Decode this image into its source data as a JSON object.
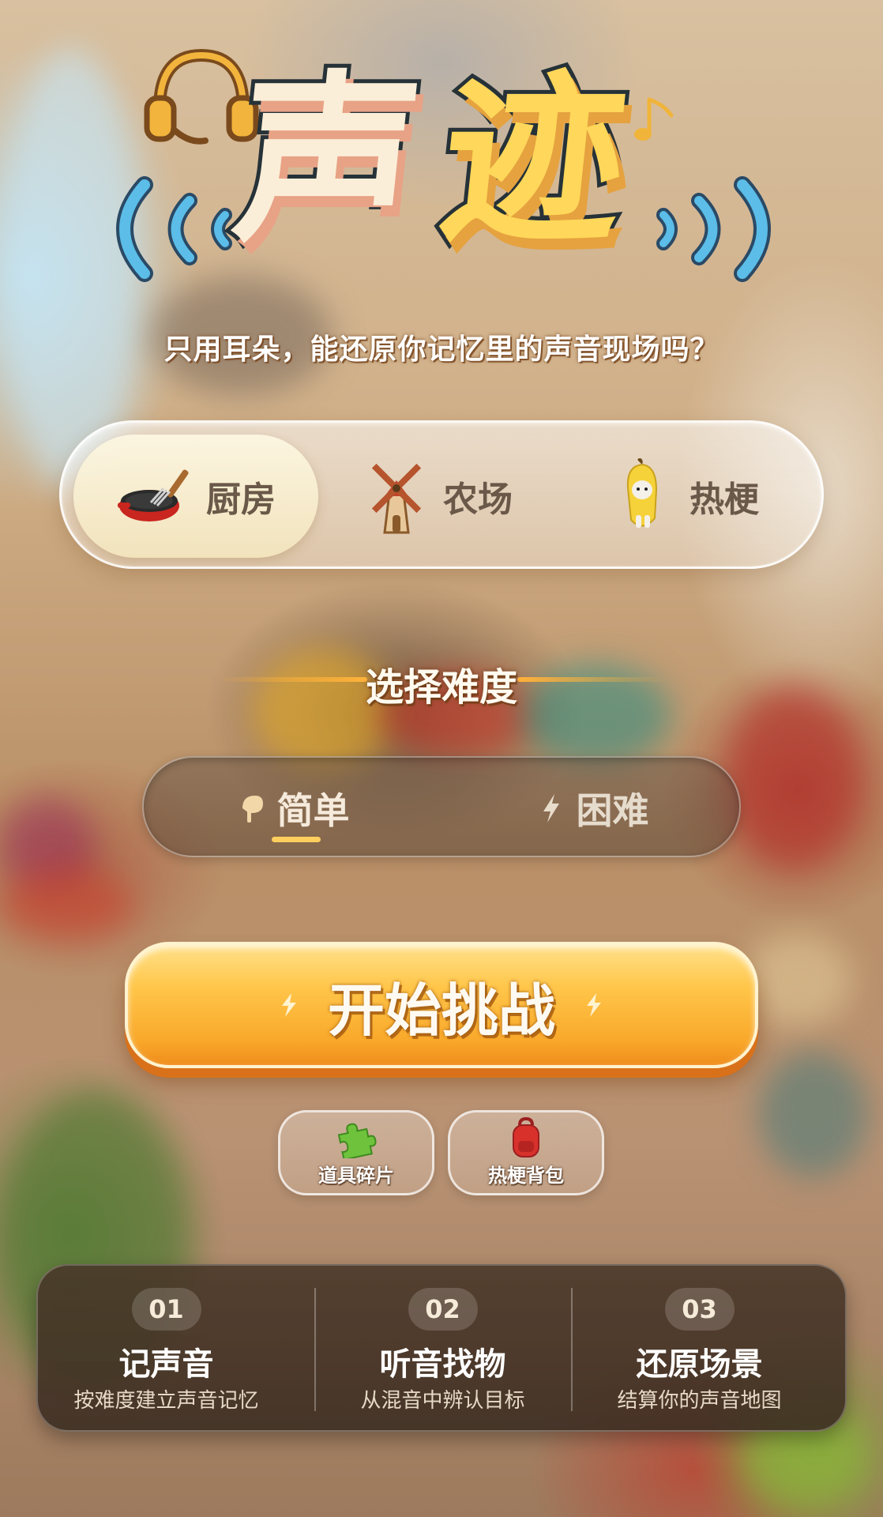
{
  "title": {
    "char1": "声",
    "char2": "迹"
  },
  "subtitle": "只用耳朵，能还原你记忆里的声音现场吗？",
  "scene_tabs": [
    {
      "label": "厨房",
      "icon": "wok-icon",
      "selected": true
    },
    {
      "label": "农场",
      "icon": "windmill-icon",
      "selected": false
    },
    {
      "label": "热梗",
      "icon": "banana-cat-icon",
      "selected": false
    }
  ],
  "difficulty": {
    "heading": "选择难度",
    "options": [
      {
        "label": "简单",
        "icon": "leaf-icon",
        "selected": true
      },
      {
        "label": "困难",
        "icon": "lightning-icon",
        "selected": false
      }
    ]
  },
  "start_button": {
    "label": "开始挑战"
  },
  "tools": [
    {
      "label": "道具碎片",
      "icon": "puzzle-piece-icon"
    },
    {
      "label": "热梗背包",
      "icon": "backpack-icon"
    }
  ],
  "steps": [
    {
      "number": "01",
      "title": "记声音",
      "desc": "按难度建立声音记忆"
    },
    {
      "number": "02",
      "title": "听音找物",
      "desc": "从混音中辨认目标"
    },
    {
      "number": "03",
      "title": "还原场景",
      "desc": "结算你的声音地图"
    }
  ],
  "colors": {
    "accent": "#ffc64a",
    "title_yellow": "#ffd75a",
    "wave_blue": "#5bbde8",
    "panel": "#483628"
  }
}
